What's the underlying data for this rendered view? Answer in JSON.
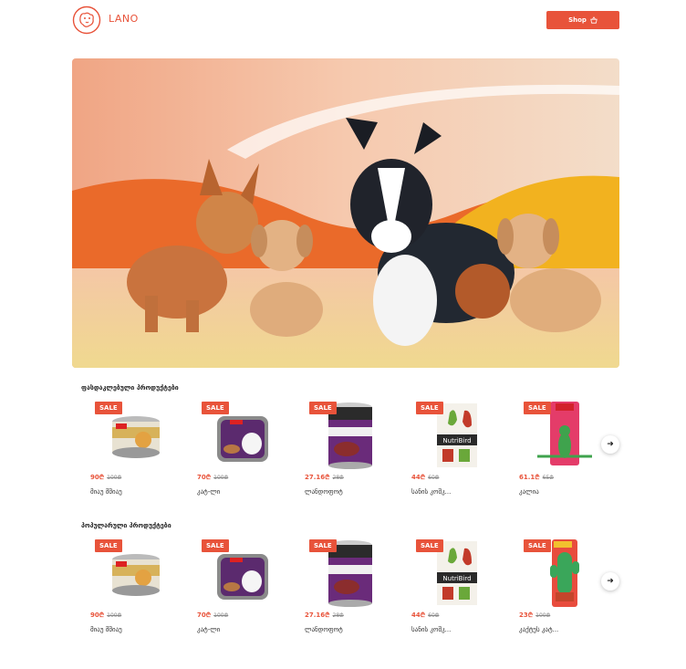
{
  "header": {
    "brand": "LANO",
    "shop_label": "Shop"
  },
  "colors": {
    "accent": "#e8533a"
  },
  "sections": [
    {
      "title": "ფასდაკლებული პროდუქტები",
      "products": [
        {
          "badge": "SALE",
          "price": "90₾",
          "old_price": "100₾",
          "name": "მიაუ მშიაუ",
          "image": "cat-food-can"
        },
        {
          "badge": "SALE",
          "price": "70₾",
          "old_price": "100₾",
          "name": "კატ-ლი",
          "image": "dog-food-tray"
        },
        {
          "badge": "SALE",
          "price": "27.16₾",
          "old_price": "28₾",
          "name": "ლანდოფოტ",
          "image": "gran-carno-can"
        },
        {
          "badge": "SALE",
          "price": "44₾",
          "old_price": "60₾",
          "name": "სანის კოშკ...",
          "image": "nutribird-box"
        },
        {
          "badge": "SALE",
          "price": "61.1₾",
          "old_price": "65₾",
          "name": "კალია",
          "image": "kong-toy"
        }
      ]
    },
    {
      "title": "პოპულარული პროდუქტები",
      "products": [
        {
          "badge": "SALE",
          "price": "90₾",
          "old_price": "100₾",
          "name": "მიაუ მშიაუ",
          "image": "cat-food-can"
        },
        {
          "badge": "SALE",
          "price": "70₾",
          "old_price": "100₾",
          "name": "კატ-ლი",
          "image": "dog-food-tray"
        },
        {
          "badge": "SALE",
          "price": "27.16₾",
          "old_price": "28₾",
          "name": "ლანდოფოტ",
          "image": "gran-carno-can"
        },
        {
          "badge": "SALE",
          "price": "44₾",
          "old_price": "60₾",
          "name": "სანის კოშკ...",
          "image": "nutribird-box"
        },
        {
          "badge": "SALE",
          "price": "23₾",
          "old_price": "100₾",
          "name": "კაქტუს კატ...",
          "image": "kong-cactus-toy"
        }
      ]
    }
  ]
}
